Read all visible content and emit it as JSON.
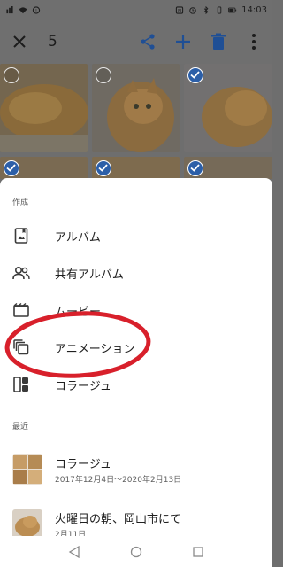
{
  "status_bar": {
    "time": "14:03",
    "icons": [
      "sim-icon",
      "wifi-icon",
      "notification-icon",
      "nfc-icon",
      "alarm-icon",
      "bluetooth-icon",
      "vibrate-icon",
      "battery-icon"
    ]
  },
  "toolbar": {
    "selected_count": "5",
    "icons": [
      "close-icon",
      "share-icon",
      "add-icon",
      "delete-icon",
      "more-vert-icon"
    ]
  },
  "create_section": {
    "label": "作成",
    "items": [
      {
        "label": "アルバム",
        "icon": "album-icon"
      },
      {
        "label": "共有アルバム",
        "icon": "shared-album-icon"
      },
      {
        "label": "ムービー",
        "icon": "movie-icon"
      },
      {
        "label": "アニメーション",
        "icon": "animation-icon"
      },
      {
        "label": "コラージュ",
        "icon": "collage-icon"
      }
    ]
  },
  "recent_section": {
    "label": "最近",
    "items": [
      {
        "title": "コラージュ",
        "subtitle": "2017年12月4日～2020年2月13日"
      },
      {
        "title": "火曜日の朝、岡山市にて",
        "subtitle": "2月11日"
      }
    ]
  },
  "colors": {
    "accent": "#2c5fa8",
    "annotation": "#d8202b",
    "dim_overlay": "#6f6f6f"
  }
}
